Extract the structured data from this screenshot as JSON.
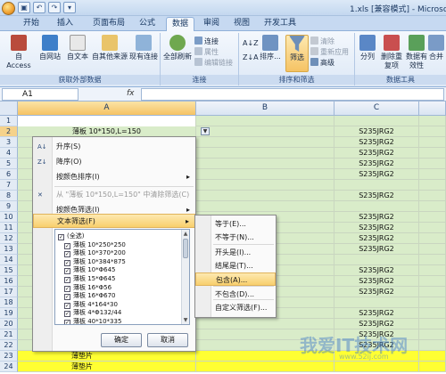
{
  "window": {
    "title": "1.xls [兼容模式] - Microso"
  },
  "tabs": [
    "开始",
    "插入",
    "页面布局",
    "公式",
    "数据",
    "审阅",
    "视图",
    "开发工具"
  ],
  "active_tab": "数据",
  "ribbon": {
    "groups": {
      "external": "获取外部数据",
      "connections": "连接",
      "sort_filter": "排序和筛选",
      "data_tools": "数据工具"
    },
    "buttons": {
      "access": "自 Access",
      "web": "自网站",
      "text": "自文本",
      "other": "自其他来源",
      "existing": "现有连接",
      "refresh_all": "全部刷新",
      "connections": "连接",
      "properties": "属性",
      "edit_links": "编辑链接",
      "sort_az": "A↓Z",
      "sort_za": "Z↓A",
      "sort": "排序...",
      "filter": "筛选",
      "clear": "清除",
      "reapply": "重新应用",
      "advanced": "高级",
      "text_to_cols": "分列",
      "remove_dup": "删除重复项",
      "validation": "数据有效性",
      "consolidate": "合并"
    }
  },
  "formula_bar": {
    "name_box": "A1",
    "fx": "fx",
    "value": ""
  },
  "columns": [
    "A",
    "B",
    "C"
  ],
  "rows": [
    {
      "num": "1",
      "a": "",
      "b": "",
      "c": ""
    },
    {
      "num": "2",
      "a": "薄板 10*150,L=150",
      "b": "",
      "c": "S235JRG2"
    },
    {
      "num": "3",
      "a": "",
      "b": "",
      "c": "S235JRG2"
    },
    {
      "num": "4",
      "a": "",
      "b": "",
      "c": "S235JRG2"
    },
    {
      "num": "5",
      "a": "",
      "b": "",
      "c": "S235JRG2"
    },
    {
      "num": "6",
      "a": "",
      "b": "",
      "c": "S235JRG2"
    },
    {
      "num": "7",
      "a": "",
      "b": "",
      "c": ""
    },
    {
      "num": "8",
      "a": "",
      "b": "",
      "c": "S235JRG2"
    },
    {
      "num": "9",
      "a": "",
      "b": "",
      "c": ""
    },
    {
      "num": "10",
      "a": "",
      "b": "",
      "c": "S235JRG2"
    },
    {
      "num": "11",
      "a": "",
      "b": "",
      "c": "S235JRG2"
    },
    {
      "num": "12",
      "a": "",
      "b": "",
      "c": "S235JRG2"
    },
    {
      "num": "13",
      "a": "",
      "b": "",
      "c": "S235JRG2"
    },
    {
      "num": "14",
      "a": "",
      "b": "",
      "c": ""
    },
    {
      "num": "15",
      "a": "",
      "b": "",
      "c": "S235JRG2"
    },
    {
      "num": "16",
      "a": "",
      "b": "",
      "c": "S235JRG2"
    },
    {
      "num": "17",
      "a": "",
      "b": "",
      "c": "S235JRG2"
    },
    {
      "num": "18",
      "a": "",
      "b": "",
      "c": ""
    },
    {
      "num": "19",
      "a": "",
      "b": "",
      "c": "S235JRG2"
    },
    {
      "num": "20",
      "a": "",
      "b": "",
      "c": "S235JRG2"
    },
    {
      "num": "21",
      "a": "",
      "b": "",
      "c": "S235JRG2"
    },
    {
      "num": "22",
      "a": "",
      "b": "",
      "c": "S235JRG2"
    },
    {
      "num": "23",
      "a": "薄垫片",
      "b": "",
      "c": ""
    },
    {
      "num": "24",
      "a": "薄垫片",
      "b": "",
      "c": ""
    }
  ],
  "filter_menu": {
    "sort_asc": "升序(S)",
    "sort_desc": "降序(O)",
    "sort_by_color": "按颜色排序(I)",
    "clear_filter": "从 \"薄板 10*150,L=150\" 中清除筛选(C)",
    "filter_by_color": "按颜色筛选(I)",
    "text_filter": "文本筛选(F)",
    "values": [
      "(全选)",
      "薄板 10*250*250",
      "薄板 10*370*200",
      "薄板 10*384*875",
      "薄板 10*Φ645",
      "薄板 15*Φ645",
      "薄板 16*Φ56",
      "薄板 16*Φ670",
      "薄板 4*164*30",
      "薄板 4*Φ132/44",
      "薄板 40*10*335"
    ],
    "ok": "确定",
    "cancel": "取消"
  },
  "text_filter_submenu": {
    "items": [
      "等于(E)...",
      "不等于(N)...",
      "开头是(I)...",
      "结尾是(T)...",
      "包含(A)...",
      "不包含(D)...",
      "自定义筛选(F)..."
    ],
    "highlighted": "包含(A)..."
  },
  "watermark": {
    "main": "我爱IT技术网",
    "sub": "www.52ij.com"
  }
}
